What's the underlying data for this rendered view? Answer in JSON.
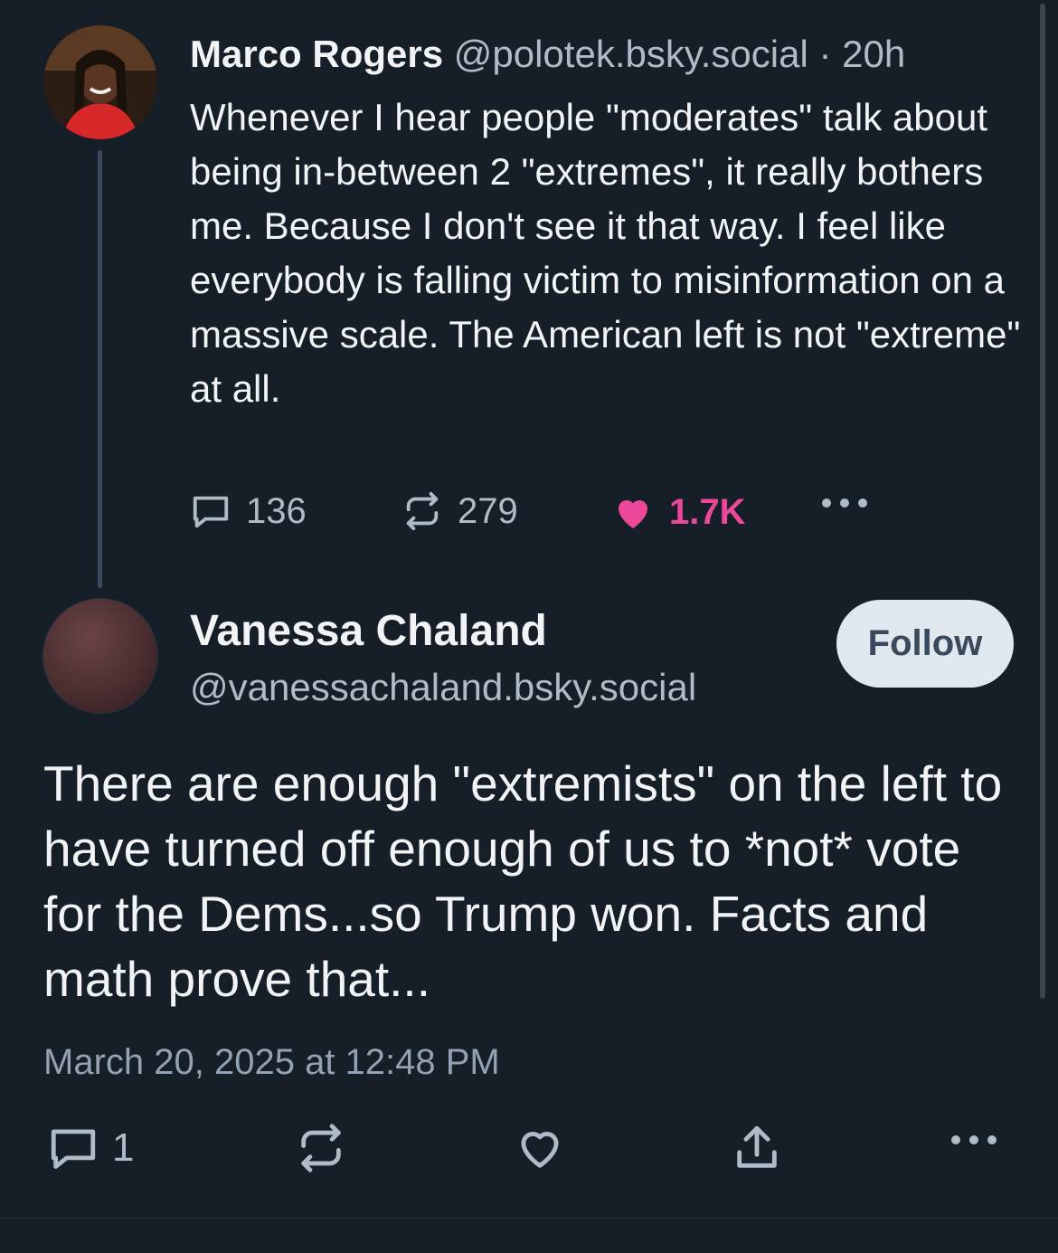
{
  "parent_post": {
    "author_name": "Marco Rogers",
    "handle": "@polotek.bsky.social",
    "time_separator": "·",
    "time": "20h",
    "text": "Whenever I hear people \"moderates\" talk about being in-between 2 \"extremes\", it really bothers me. Because I don't see it that way. I feel like everybody is falling victim to misinformation on a massive scale. The American left is not \"extreme\" at all.",
    "reply_count": "136",
    "repost_count": "279",
    "like_count": "1.7K",
    "like_color": "#ec4899",
    "liked": true,
    "icons": [
      "reply-icon",
      "repost-icon",
      "heart-icon",
      "more-icon"
    ]
  },
  "reply_post": {
    "author_name": "Vanessa Chaland",
    "handle": "@vanessachaland.bsky.social",
    "follow_label": "Follow",
    "text": "There are enough \"extremists\" on the left to have turned off enough of us to *not* vote for the Dems...so Trump won. Facts and math prove that...",
    "timestamp": "March 20, 2025 at 12:48 PM",
    "reply_count": "1",
    "icons": [
      "reply-icon",
      "repost-icon",
      "heart-icon",
      "share-icon",
      "more-icon"
    ]
  },
  "colors": {
    "background": "#161e27",
    "text": "#f1f3f5",
    "muted": "#aebbc9",
    "follow_button_bg": "#e1e7ee"
  }
}
